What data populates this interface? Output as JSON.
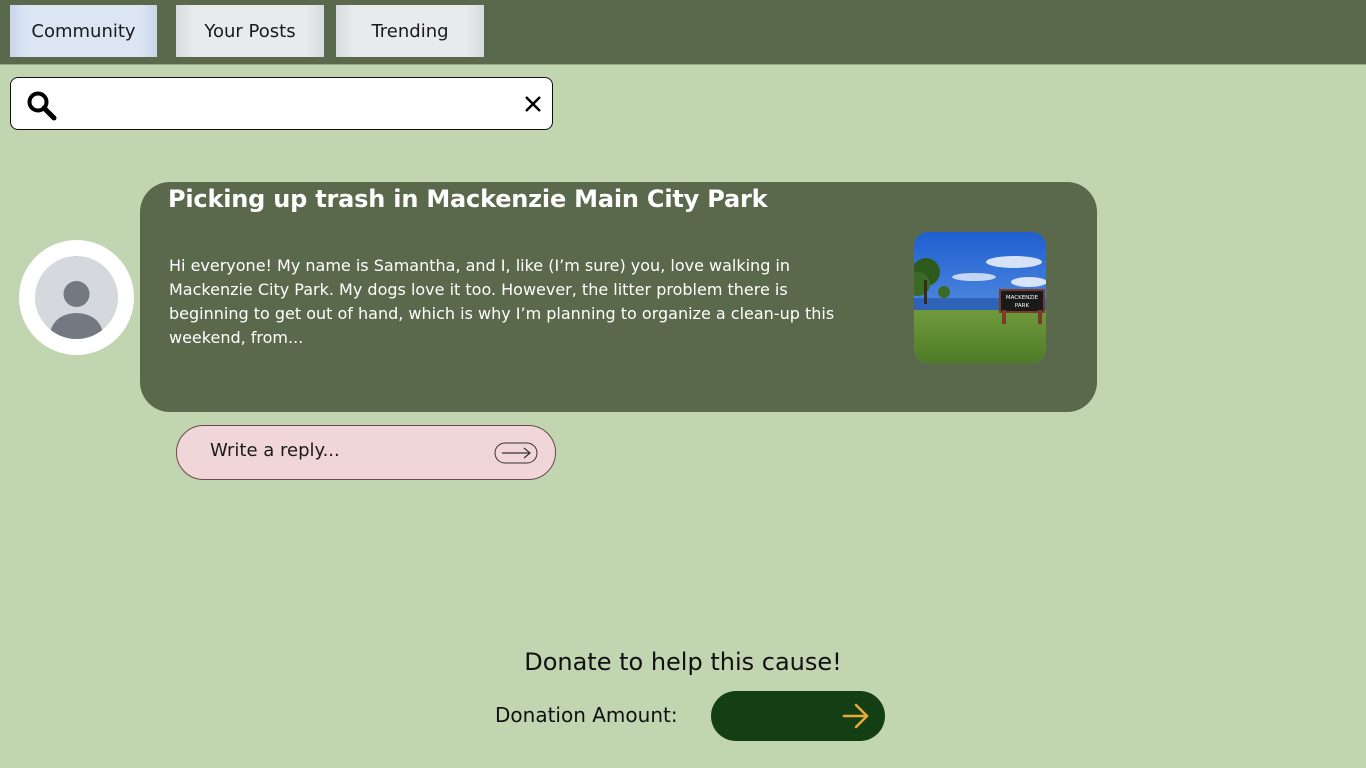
{
  "tabs": [
    {
      "label": "Community",
      "active": true
    },
    {
      "label": "Your Posts",
      "active": false
    },
    {
      "label": "Trending",
      "active": false
    }
  ],
  "search": {
    "placeholder": "",
    "search_icon": "search-icon",
    "clear_icon": "close-icon"
  },
  "post": {
    "title": "Picking up trash in Mackenzie Main City Park",
    "body": "Hi everyone! My name is Samantha, and I, like (I’m sure) you, love walking in Mackenzie City Park. My dogs love it too. However, the litter problem there is beginning to get out of hand, which is why I’m planning to organize a clean-up this weekend, from...",
    "avatar_icon": "user-avatar-icon",
    "image_sign_line1": "MACKENZIE",
    "image_sign_line2": "PARK"
  },
  "reply": {
    "placeholder": "Write a reply...",
    "send_icon": "arrow-right-icon"
  },
  "donation": {
    "heading": "Donate to help this cause!",
    "label": "Donation Amount:",
    "submit_icon": "arrow-right-icon"
  },
  "colors": {
    "background": "#c1d5b0",
    "top_bar": "#5a694b",
    "card": "#5a694b",
    "reply_bg": "#f0d6d8",
    "donate_button": "#143f14",
    "donate_arrow": "#e8a83a"
  }
}
